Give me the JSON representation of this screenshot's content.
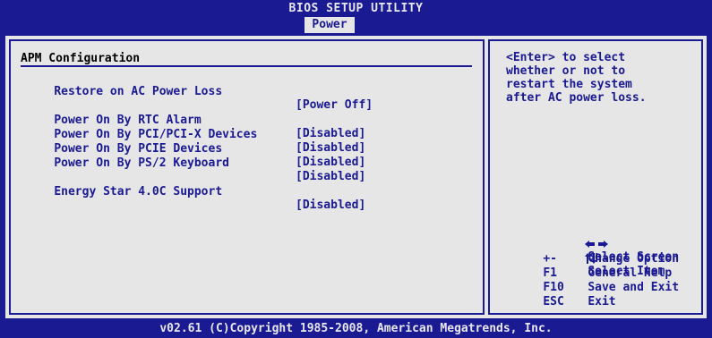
{
  "window": {
    "title": "BIOS SETUP UTILITY",
    "active_tab": "Power"
  },
  "main": {
    "section_title": "APM Configuration",
    "items": [
      {
        "label": "Restore on AC Power Loss",
        "value": "[Power Off]"
      },
      {
        "label": "Power On By RTC Alarm",
        "value": "[Disabled]"
      },
      {
        "label": "Power On By PCI/PCI-X Devices",
        "value": "[Disabled]"
      },
      {
        "label": "Power On By PCIE Devices",
        "value": "[Disabled]"
      },
      {
        "label": "Power On By PS/2 Keyboard",
        "value": "[Disabled]"
      },
      {
        "label": "Energy Star 4.0C Support",
        "value": "[Disabled]"
      }
    ]
  },
  "help": {
    "lines": [
      "<Enter> to select",
      "whether or not to",
      "restart the system",
      "after AC power loss."
    ]
  },
  "legend": [
    {
      "key": "",
      "icon": "left-right-arrows-icon",
      "desc": "Select Screen"
    },
    {
      "key": "",
      "icon": "up-down-arrows-icon",
      "desc": "Select Item"
    },
    {
      "key": "+-",
      "icon": "",
      "desc": "Change Option"
    },
    {
      "key": "F1",
      "icon": "",
      "desc": "General Help"
    },
    {
      "key": "F10",
      "icon": "",
      "desc": "Save and Exit"
    },
    {
      "key": "ESC",
      "icon": "",
      "desc": "Exit"
    }
  ],
  "footer": {
    "text": "v02.61 (C)Copyright 1985-2008, American Megatrends, Inc."
  },
  "colors": {
    "background": "#1a1a92",
    "panel": "#e6e6e6",
    "text": "#1a1a92"
  }
}
